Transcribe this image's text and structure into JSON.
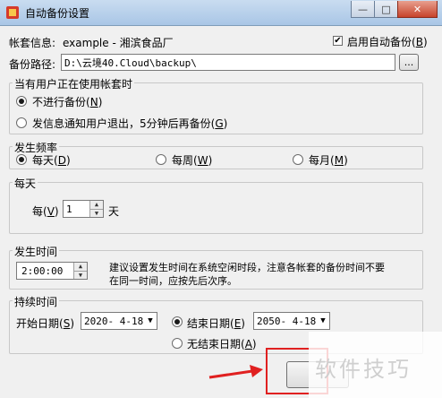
{
  "window": {
    "title": "自动备份设置",
    "minimize_glyph": "—",
    "maximize_glyph": "□",
    "close_glyph": "✕",
    "icon": "app-icon"
  },
  "account": {
    "label": "帐套信息:",
    "value": "example - 湘滨食品厂",
    "auto_backup_checked": true,
    "auto_backup_label": "启用自动备份",
    "auto_backup_key": "B"
  },
  "path": {
    "label": "备份路径:",
    "value": "D:\\云境40.Cloud\\backup\\",
    "browse_label": "..."
  },
  "in_use": {
    "legend": "当有用户正在使用帐套时",
    "options": [
      {
        "label": "不进行备份",
        "key": "N",
        "selected": true
      },
      {
        "label": "发信息通知用户退出，5分钟后再备份",
        "key": "G",
        "selected": false
      }
    ]
  },
  "frequency": {
    "legend": "发生频率",
    "options": [
      {
        "label": "每天",
        "key": "D",
        "selected": true
      },
      {
        "label": "每周",
        "key": "W",
        "selected": false
      },
      {
        "label": "每月",
        "key": "M",
        "selected": false
      }
    ]
  },
  "daily": {
    "legend": "每天",
    "prefix": "每",
    "key": "V",
    "value": "1",
    "suffix": "天"
  },
  "time": {
    "legend": "发生时间",
    "value": "2:00:00",
    "hint_line1": "建议设置发生时间在系统空闲时段，注意各帐套的备份时间不要",
    "hint_line2": "在同一时间，应按先后次序。"
  },
  "duration": {
    "legend": "持续时间",
    "start_label": "开始日期",
    "start_key": "S",
    "start_value": "2020- 4-18",
    "end_label": "结束日期",
    "end_key": "E",
    "end_value": "2050- 4-18",
    "end_selected": true,
    "no_end_label": "无结束日期",
    "no_end_key": "A",
    "no_end_selected": false
  },
  "watermark": "软件技巧",
  "colors": {
    "arrow": "#e02020",
    "highlight_box": "#e02020"
  }
}
